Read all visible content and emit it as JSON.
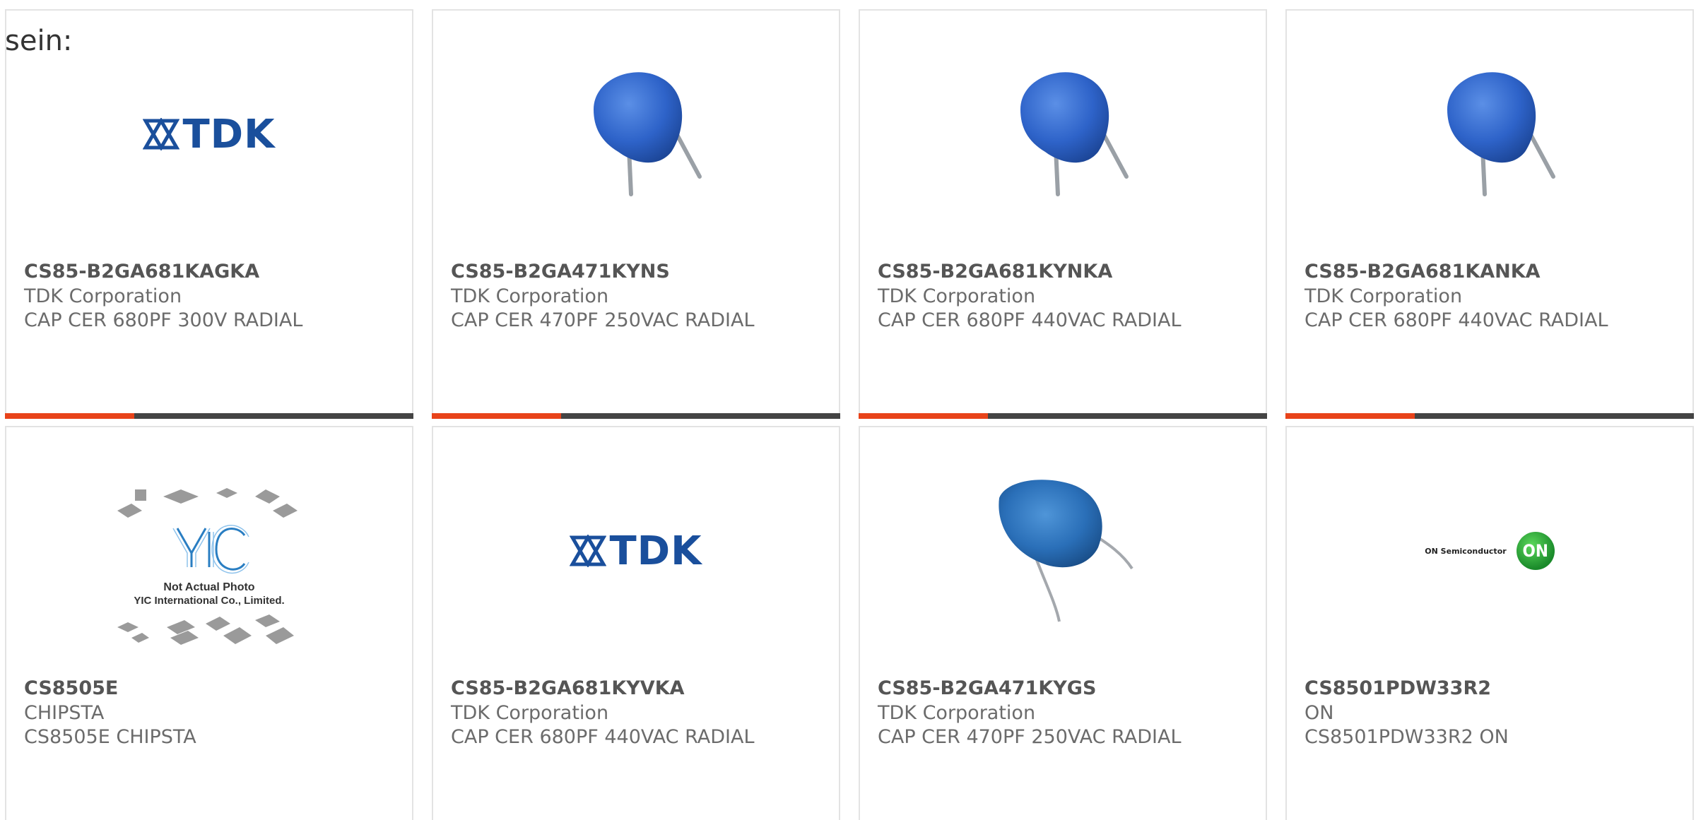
{
  "intro_text": "sein:",
  "accent_color": "#e8431a",
  "products": [
    {
      "part": "CS85-B2GA681KAGKA",
      "manufacturer": "TDK Corporation",
      "description": "CAP CER 680PF 300V RADIAL",
      "image": "tdk-logo",
      "has_accent_bar": true
    },
    {
      "part": "CS85-B2GA471KYNS",
      "manufacturer": "TDK Corporation",
      "description": "CAP CER 470PF 250VAC RADIAL",
      "image": "ceramic-capacitor",
      "has_accent_bar": true
    },
    {
      "part": "CS85-B2GA681KYNKA",
      "manufacturer": "TDK Corporation",
      "description": "CAP CER 680PF 440VAC RADIAL",
      "image": "ceramic-capacitor",
      "has_accent_bar": true
    },
    {
      "part": "CS85-B2GA681KANKA",
      "manufacturer": "TDK Corporation",
      "description": "CAP CER 680PF 440VAC RADIAL",
      "image": "ceramic-capacitor",
      "has_accent_bar": true
    },
    {
      "part": "CS8505E",
      "manufacturer": "CHIPSTA",
      "description": "CS8505E CHIPSTA",
      "image": "yic-placeholder",
      "image_caption_line1": "Not Actual Photo",
      "image_caption_line2": "YIC International Co., Limited.",
      "has_accent_bar": false
    },
    {
      "part": "CS85-B2GA681KYVKA",
      "manufacturer": "TDK Corporation",
      "description": "CAP CER 680PF 440VAC RADIAL",
      "image": "tdk-logo",
      "has_accent_bar": false
    },
    {
      "part": "CS85-B2GA471KYGS",
      "manufacturer": "TDK Corporation",
      "description": "CAP CER 470PF 250VAC RADIAL",
      "image": "ceramic-capacitor-long-leads",
      "has_accent_bar": false
    },
    {
      "part": "CS8501PDW33R2",
      "manufacturer": "ON",
      "description": "CS8501PDW33R2 ON",
      "image": "on-semiconductor-logo",
      "has_accent_bar": false
    }
  ],
  "tdk_logo_text": "TDK",
  "on_logo_text": "ON Semiconductor",
  "on_logo_mark": "ON"
}
